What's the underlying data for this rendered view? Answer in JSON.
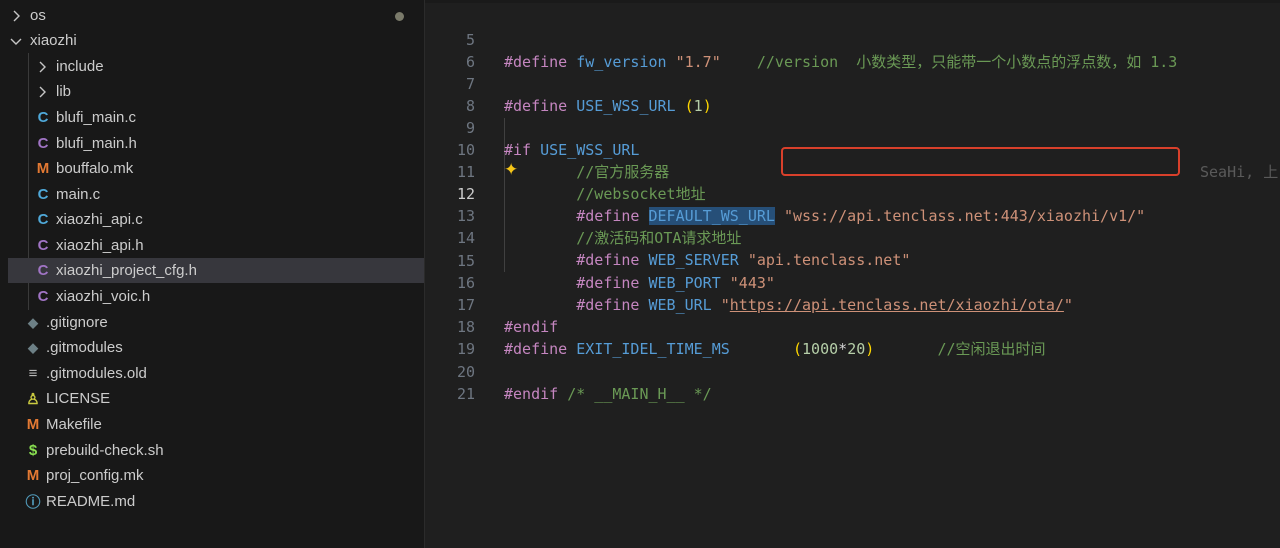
{
  "explorer": {
    "items": [
      {
        "label": "os",
        "kind": "folder",
        "expanded": false,
        "icon": "chevron-right-icon"
      },
      {
        "label": "xiaozhi",
        "kind": "folder",
        "expanded": true,
        "icon": "chevron-down-icon"
      },
      {
        "label": "include",
        "kind": "folder",
        "expanded": false,
        "icon": "chevron-right-icon"
      },
      {
        "label": "lib",
        "kind": "folder",
        "expanded": false,
        "icon": "chevron-right-icon"
      },
      {
        "label": "blufi_main.c",
        "kind": "file",
        "glyph": "C",
        "icon": "c-file-icon"
      },
      {
        "label": "blufi_main.h",
        "kind": "file",
        "glyph": "C",
        "icon": "h-file-icon"
      },
      {
        "label": "bouffalo.mk",
        "kind": "file",
        "glyph": "M",
        "icon": "makefile-icon"
      },
      {
        "label": "main.c",
        "kind": "file",
        "glyph": "C",
        "icon": "c-file-icon"
      },
      {
        "label": "xiaozhi_api.c",
        "kind": "file",
        "glyph": "C",
        "icon": "c-file-icon"
      },
      {
        "label": "xiaozhi_api.h",
        "kind": "file",
        "glyph": "C",
        "icon": "h-file-icon"
      },
      {
        "label": "xiaozhi_project_cfg.h",
        "kind": "file",
        "glyph": "C",
        "icon": "h-file-icon",
        "selected": true
      },
      {
        "label": "xiaozhi_voic.h",
        "kind": "file",
        "glyph": "C",
        "icon": "h-file-icon"
      },
      {
        "label": ".gitignore",
        "kind": "file",
        "glyph": "◆",
        "icon": "git-icon"
      },
      {
        "label": ".gitmodules",
        "kind": "file",
        "glyph": "◆",
        "icon": "git-icon"
      },
      {
        "label": ".gitmodules.old",
        "kind": "file",
        "glyph": "≡",
        "icon": "text-lines-icon"
      },
      {
        "label": "LICENSE",
        "kind": "file",
        "glyph": "♙",
        "icon": "license-icon"
      },
      {
        "label": "Makefile",
        "kind": "file",
        "glyph": "M",
        "icon": "makefile-icon"
      },
      {
        "label": "prebuild-check.sh",
        "kind": "file",
        "glyph": "$",
        "icon": "shell-script-icon"
      },
      {
        "label": "proj_config.mk",
        "kind": "file",
        "glyph": "M",
        "icon": "makefile-icon"
      },
      {
        "label": "README.md",
        "kind": "file",
        "glyph": "ⓘ",
        "icon": "info-icon"
      }
    ]
  },
  "editor": {
    "lines": [
      {
        "n": "5",
        "text": "#define fw_version \"1.7\"    //version  小数类型，只能带一个小数点的浮点数，如 1.3"
      },
      {
        "n": "6",
        "text": ""
      },
      {
        "n": "7",
        "text": "#define USE_WSS_URL (1)"
      },
      {
        "n": "8",
        "text": ""
      },
      {
        "n": "9",
        "text": "#if USE_WSS_URL"
      },
      {
        "n": "10",
        "text": "        //官方服务器"
      },
      {
        "n": "11",
        "text": "        //websocket地址"
      },
      {
        "n": "12",
        "text": "        #define DEFAULT_WS_URL \"wss://api.tenclass.net:443/xiaozhi/v1/\""
      },
      {
        "n": "13",
        "text": "        //激活码和OTA请求地址"
      },
      {
        "n": "14",
        "text": "        #define WEB_SERVER \"api.tenclass.net\""
      },
      {
        "n": "15",
        "text": "        #define WEB_PORT \"443\""
      },
      {
        "n": "16",
        "text": "        #define WEB_URL \"https://api.tenclass.net/xiaozhi/ota/\""
      },
      {
        "n": "17",
        "text": "#endif"
      },
      {
        "n": "18",
        "text": "#define EXIT_IDEL_TIME_MS       (1000*20)       //空闲退出时间"
      },
      {
        "n": "19",
        "text": ""
      },
      {
        "n": "20",
        "text": "#endif /* __MAIN_H__ */"
      },
      {
        "n": "21",
        "text": ""
      }
    ],
    "active_line": "12",
    "blame_text": "SeaHi, 上",
    "highlight_box_color": "#d9402b",
    "sparkle_icon": "sparkle-icon"
  }
}
